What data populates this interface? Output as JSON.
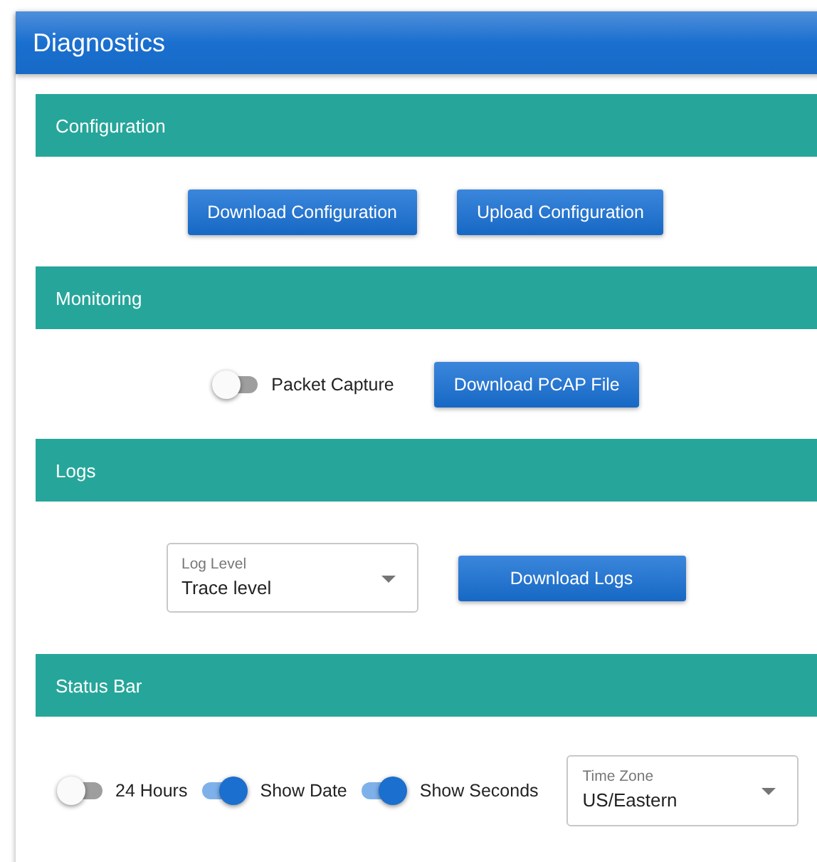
{
  "window": {
    "title": "Diagnostics"
  },
  "sections": [
    {
      "title": "Configuration",
      "items": [
        {
          "kind": "button",
          "label": "Download Configuration"
        },
        {
          "kind": "button",
          "label": "Upload Configuration"
        }
      ]
    },
    {
      "title": "Monitoring",
      "items": [
        {
          "kind": "toggle",
          "label": "Packet Capture",
          "on": false
        },
        {
          "kind": "button",
          "label": "Download PCAP File"
        }
      ]
    },
    {
      "title": "Logs",
      "items": [
        {
          "kind": "select",
          "label": "Log Level",
          "value": "Trace level"
        },
        {
          "kind": "button",
          "label": "Download Logs"
        }
      ]
    },
    {
      "title": "Status Bar",
      "items": [
        {
          "kind": "toggle",
          "label": "24 Hours",
          "on": false
        },
        {
          "kind": "toggle",
          "label": "Show Date",
          "on": true
        },
        {
          "kind": "toggle",
          "label": "Show Seconds",
          "on": true
        },
        {
          "kind": "select",
          "label": "Time Zone",
          "value": "US/Eastern"
        }
      ]
    }
  ]
}
